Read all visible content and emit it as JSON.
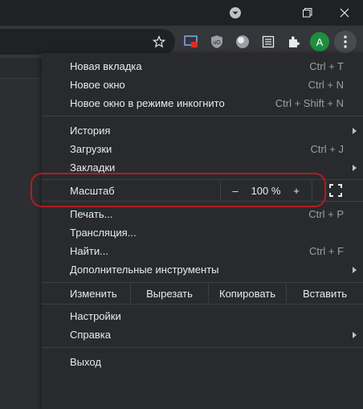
{
  "colors": {
    "accent_highlight": "#b01e1e",
    "avatar_bg": "#1e8e3e"
  },
  "toolbar": {
    "avatar_letter": "A"
  },
  "icons": {
    "titlebar": [
      "chevron-down-icon",
      "restore-icon",
      "close-icon"
    ],
    "toolbar": [
      "star-icon",
      "cast-extension-icon",
      "ublock-icon",
      "circle-extension-icon",
      "document-extension-icon",
      "puzzle-icon",
      "kebab-menu-icon"
    ]
  },
  "menu": {
    "new_tab": {
      "label": "Новая вкладка",
      "shortcut": "Ctrl + T"
    },
    "new_window": {
      "label": "Новое окно",
      "shortcut": "Ctrl + N"
    },
    "incognito": {
      "label": "Новое окно в режиме инкогнито",
      "shortcut": "Ctrl + Shift + N"
    },
    "history": {
      "label": "История"
    },
    "downloads": {
      "label": "Загрузки",
      "shortcut": "Ctrl + J"
    },
    "bookmarks": {
      "label": "Закладки"
    },
    "zoom": {
      "label": "Масштаб",
      "minus": "–",
      "value": "100 %",
      "plus": "+"
    },
    "print": {
      "label": "Печать...",
      "shortcut": "Ctrl + P"
    },
    "cast": {
      "label": "Трансляция..."
    },
    "find": {
      "label": "Найти...",
      "shortcut": "Ctrl + F"
    },
    "more_tools": {
      "label": "Дополнительные инструменты"
    },
    "edit": {
      "label": "Изменить",
      "cut": "Вырезать",
      "copy": "Копировать",
      "paste": "Вставить"
    },
    "settings": {
      "label": "Настройки"
    },
    "help": {
      "label": "Справка"
    },
    "exit": {
      "label": "Выход"
    }
  }
}
